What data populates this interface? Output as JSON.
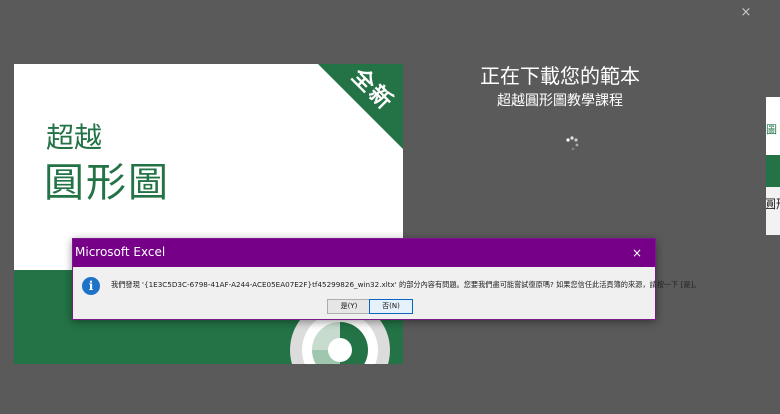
{
  "window": {
    "close_glyph": "×"
  },
  "side_panel": {
    "text_top": "圖",
    "text_bottom": "圓形"
  },
  "template": {
    "corner_label": "全新",
    "title_small": "超越",
    "title_large": "圓形圖",
    "accent_color": "#237346"
  },
  "download": {
    "title": "正在下載您的範本",
    "subtitle": "超越圓形圖教學課程"
  },
  "dialog": {
    "title": "Microsoft Excel",
    "close_glyph": "×",
    "icon": "info-icon",
    "message": "我們發現 '{1E3C5D3C-6798-41AF-A244-ACE05EA07E2F}tf45299826_win32.xltx' 的部分內容有問題。您要我們盡可能嘗試復原嗎? 如果您信任此活頁簿的來源，請按一下 [是]。",
    "yes_label": "是(Y)",
    "no_label": "否(N)",
    "titlebar_color": "#760087"
  }
}
